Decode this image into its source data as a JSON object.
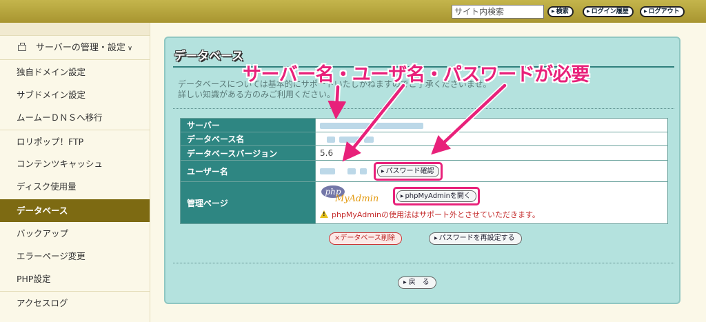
{
  "header": {
    "search_placeholder": "サイト内検索",
    "search_button": "検索",
    "login_history_button": "ログイン履歴",
    "logout_button": "ログアウト"
  },
  "sidebar": {
    "section_title": "サーバーの管理・設定",
    "items": [
      {
        "label": "独自ドメイン設定"
      },
      {
        "label": "サブドメイン設定"
      },
      {
        "label": "ムームーＤＮＳへ移行"
      },
      {
        "label": "ロリポップ！FTP"
      },
      {
        "label": "コンテンツキャッシュ"
      },
      {
        "label": "ディスク使用量"
      },
      {
        "label": "データベース"
      },
      {
        "label": "バックアップ"
      },
      {
        "label": "エラーページ変更"
      },
      {
        "label": "PHP設定"
      },
      {
        "label": "アクセスログ"
      }
    ],
    "active_item": "データベース"
  },
  "main": {
    "title": "データベース",
    "description_line1": "データベースについては基本的にサポートいたしかねますのでご了承くださいませ。",
    "description_line2": "詳しい知識がある方のみご利用ください。",
    "table": {
      "server_label": "サーバー",
      "dbname_label": "データベース名",
      "dbversion_label": "データベースバージョン",
      "dbversion_value": "5.6",
      "username_label": "ユーザー名",
      "password_confirm_button": "パスワード確認",
      "admin_label": "管理ページ",
      "phpmyadmin_logo_php": "php",
      "phpmyadmin_logo_my": "MyAdmin",
      "phpmyadmin_button": "phpMyAdminを開く",
      "warning_text": "phpMyAdminの使用法はサポート外とさせていただきます。"
    },
    "delete_button": "×データベース削除",
    "reset_password_button": "パスワードを再設定する",
    "back_button": "戻　る"
  },
  "annotation": {
    "text": "サーバー名・ユーザ名・パスワードが必要",
    "color": "#e8217a"
  },
  "colors": {
    "topbar": "#b5a23c",
    "sidebar_active": "#7d6a12",
    "panel_bg": "#b4e2de",
    "table_header": "#2e8682",
    "warning": "#c52d2d"
  }
}
